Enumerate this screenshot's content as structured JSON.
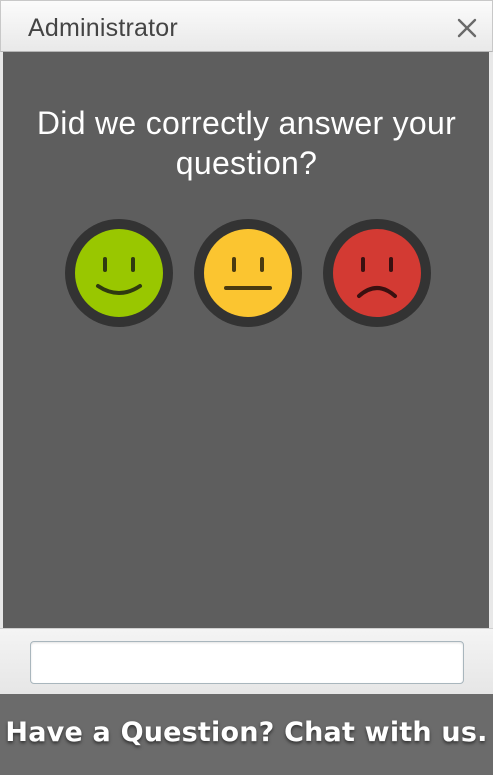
{
  "header": {
    "title": "Administrator",
    "close_icon": "close-icon"
  },
  "survey": {
    "question": "Did we correctly answer your question?",
    "options": [
      {
        "icon": "happy-face-icon",
        "color": "#99c700"
      },
      {
        "icon": "neutral-face-icon",
        "color": "#fbc530"
      },
      {
        "icon": "sad-face-icon",
        "color": "#d33a33"
      }
    ],
    "ring_color": "#333333"
  },
  "composer": {
    "value": "",
    "placeholder": ""
  },
  "footer": {
    "cta_label": "Have a Question? Chat with us."
  }
}
